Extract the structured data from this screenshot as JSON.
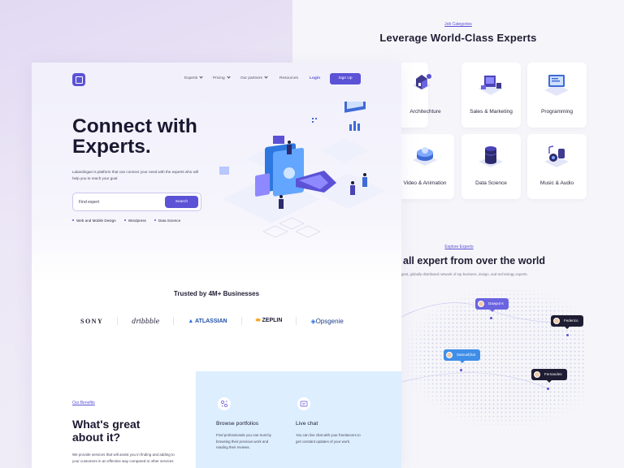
{
  "categories": {
    "tag": "Job Categories",
    "title": "Leverage World-Class Experts",
    "items": [
      {
        "label": "Architechture",
        "icon": "house-icon"
      },
      {
        "label": "Sales & Marketing",
        "icon": "marketing-icon"
      },
      {
        "label": "Programming",
        "icon": "laptop-icon"
      },
      {
        "label": "Video & Animation",
        "icon": "video-icon"
      },
      {
        "label": "Data Science",
        "icon": "database-icon"
      },
      {
        "label": "Music & Audio",
        "icon": "music-icon"
      }
    ]
  },
  "explore": {
    "tag": "Explore Experts",
    "title": "all expert from over the world",
    "subtitle": "gest, globally-distributed network of top business, design, and technology experts.",
    "pins": [
      "Dawpul K",
      "Federico",
      "Samuel(hat",
      "Fernandes"
    ]
  },
  "nav": {
    "items": [
      "Experts",
      "Pricing",
      "Our partners",
      "Resources"
    ],
    "login": "Login",
    "signup": "Sign Up"
  },
  "hero": {
    "title_line1": "Connect with",
    "title_line2": "Experts.",
    "description": "Lalandingan is platform that can connect your need with the experts who will help you to reach your goal",
    "search_placeholder": "Find expert",
    "search_button": "Search",
    "tags": [
      "Web and Mobile Design",
      "Wordpress",
      "Data Science"
    ]
  },
  "trusted": {
    "title": "Trusted by 4M+ Businesses",
    "brands": [
      "SONY",
      "dribbble",
      "ATLASSIAN",
      "ZEPLIN",
      "Opsgenie"
    ]
  },
  "benefits": {
    "tag": "Our Benefits",
    "title": "What's great about it?",
    "description": "We provide services that will assist you in finding and adding to your customers in an effective way compared to other services",
    "features": [
      {
        "title": "Browse portfolios",
        "description": "Find professionals you can trust by browsing their previous work and reading their reviews."
      },
      {
        "title": "Live chat",
        "description": "You can live chat with your freelancers to get constant updates of your work."
      }
    ]
  },
  "colors": {
    "accent": "#5b52d6",
    "dark": "#1a1830",
    "benefit_bg": "#ddeefe"
  }
}
